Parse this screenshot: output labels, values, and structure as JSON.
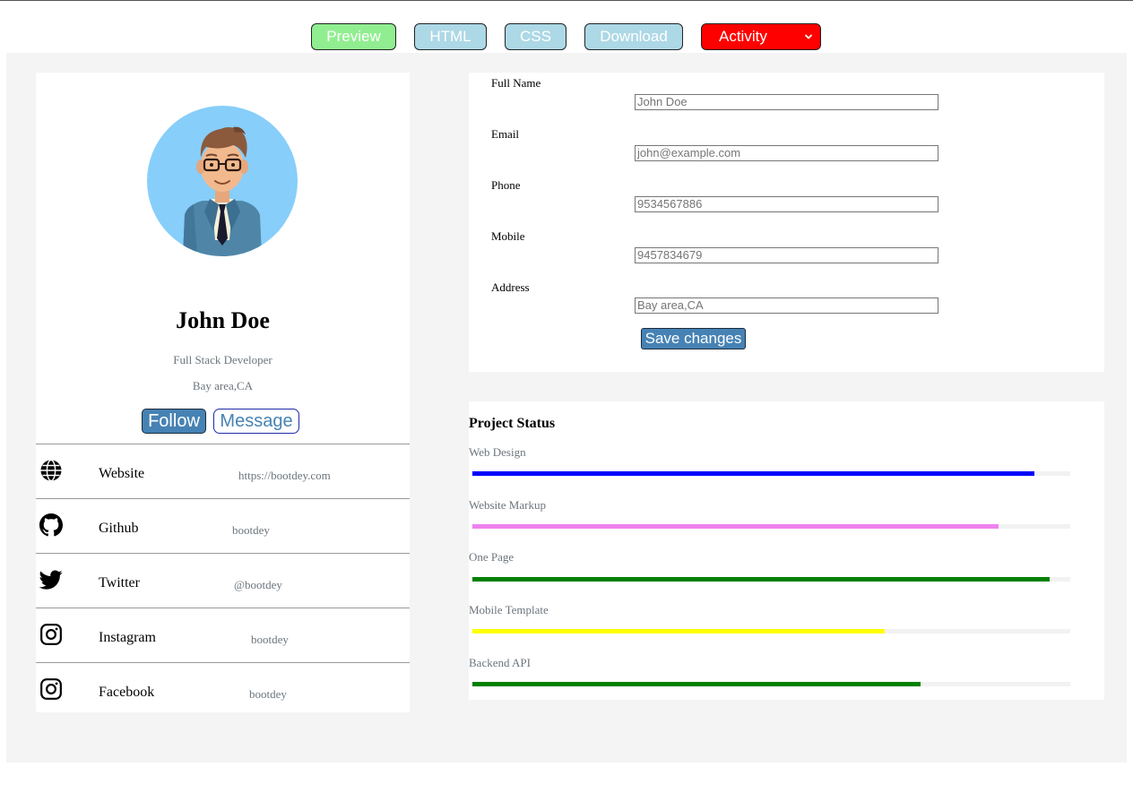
{
  "toolbar": {
    "preview": "Preview",
    "html": "HTML",
    "css": "CSS",
    "download": "Download",
    "activity": "Activity"
  },
  "profile": {
    "name": "John Doe",
    "title": "Full Stack Developer",
    "location": "Bay area,CA",
    "follow": "Follow",
    "message": "Message",
    "social": [
      {
        "icon": "globe-icon",
        "label": "Website",
        "value": "https://bootdey.com"
      },
      {
        "icon": "github-icon",
        "label": "Github",
        "value": "bootdey"
      },
      {
        "icon": "twitter-icon",
        "label": "Twitter",
        "value": "@bootdey"
      },
      {
        "icon": "instagram-icon",
        "label": "Instagram",
        "value": "bootdey"
      },
      {
        "icon": "instagram-icon",
        "label": "Facebook",
        "value": "bootdey"
      }
    ]
  },
  "form": {
    "fields": [
      {
        "label": "Full Name",
        "placeholder": "John Doe"
      },
      {
        "label": "Email",
        "placeholder": "john@example.com"
      },
      {
        "label": "Phone",
        "placeholder": "9534567886"
      },
      {
        "label": "Mobile",
        "placeholder": "9457834679"
      },
      {
        "label": "Address",
        "placeholder": "Bay area,CA"
      }
    ],
    "save": "Save changes"
  },
  "project_status": {
    "title": "Project Status",
    "items": [
      {
        "label": "Web Design",
        "progress": 0.94,
        "color": "#0000ff"
      },
      {
        "label": "Website Markup",
        "progress": 0.88,
        "color": "#ee82ee"
      },
      {
        "label": "One Page",
        "progress": 0.965,
        "color": "#008000"
      },
      {
        "label": "Mobile Template",
        "progress": 0.69,
        "color": "#ffff00"
      },
      {
        "label": "Backend API",
        "progress": 0.75,
        "color": "#008000"
      }
    ]
  },
  "colors": {
    "preview_bg": "#90ee90",
    "tab_bg": "#add8e6",
    "activity_bg": "#ff0000",
    "primary": "#4682b4",
    "panel_bg": "#f4f4f4"
  }
}
